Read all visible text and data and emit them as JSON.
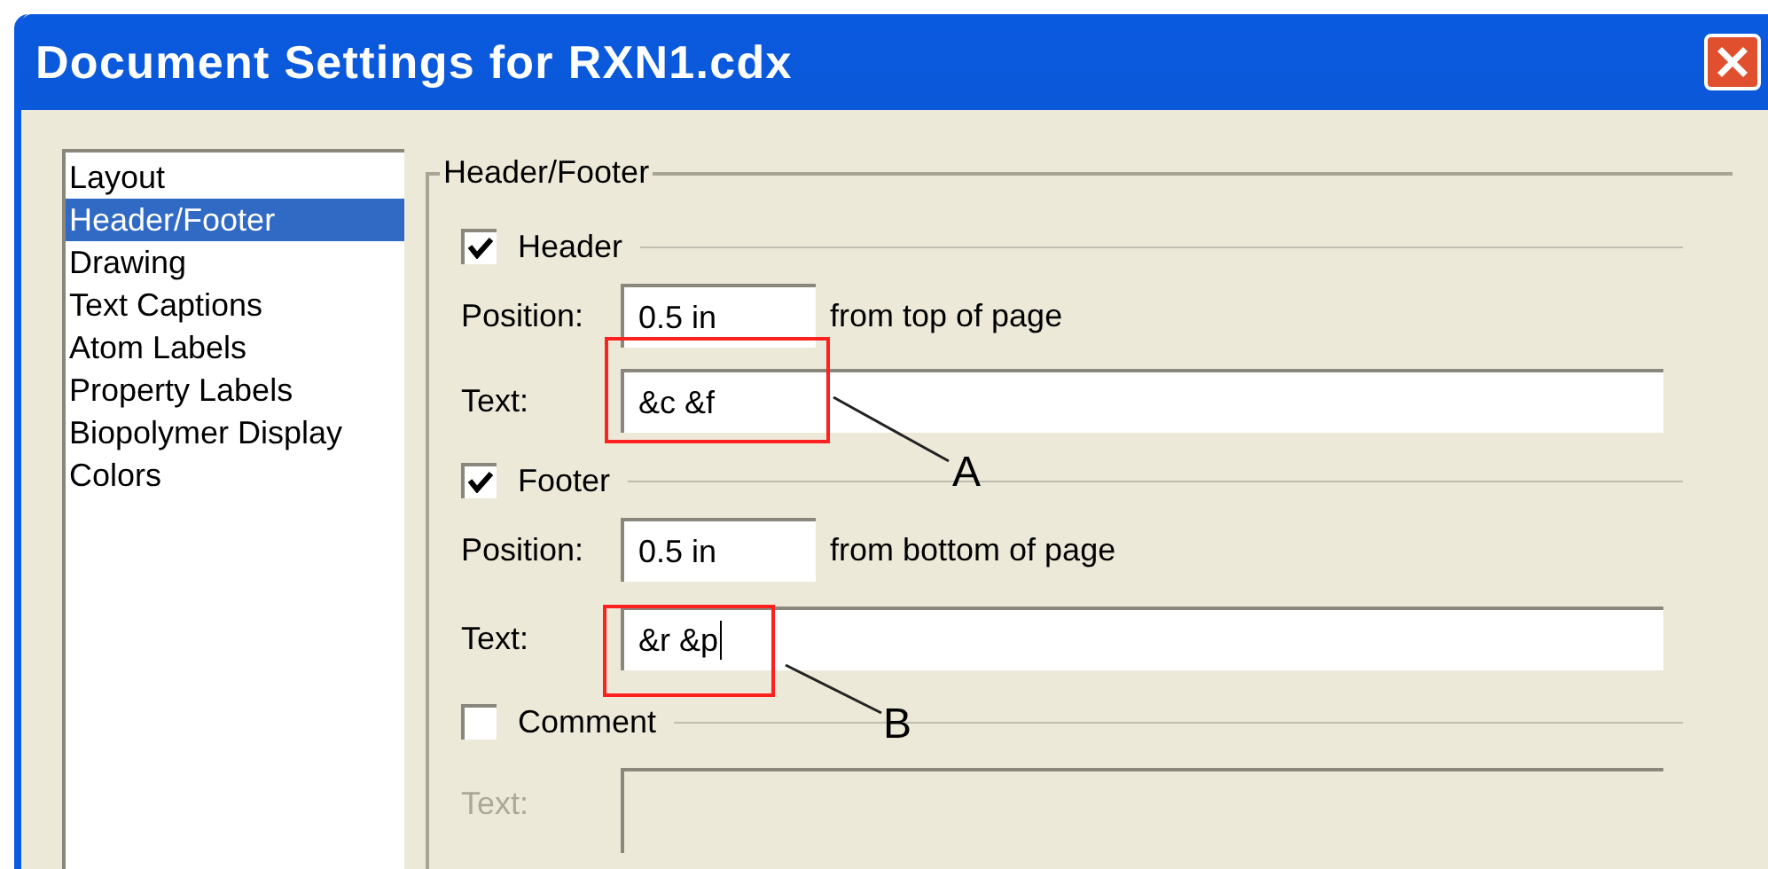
{
  "window": {
    "title": "Document Settings for RXN1.cdx"
  },
  "sidebar": {
    "items": [
      {
        "label": "Layout",
        "selected": false
      },
      {
        "label": "Header/Footer",
        "selected": true
      },
      {
        "label": "Drawing",
        "selected": false
      },
      {
        "label": "Text Captions",
        "selected": false
      },
      {
        "label": "Atom Labels",
        "selected": false
      },
      {
        "label": "Property Labels",
        "selected": false
      },
      {
        "label": "Biopolymer Display",
        "selected": false
      },
      {
        "label": "Colors",
        "selected": false
      }
    ]
  },
  "group": {
    "title": "Header/Footer"
  },
  "sections": [
    {
      "label": "Header",
      "checked": true,
      "position": {
        "label": "Position:",
        "value": "0.5 in",
        "suffix": "from top of page"
      },
      "text": {
        "label": "Text:",
        "value": "&c &f",
        "disabled": false,
        "focused": false
      }
    },
    {
      "label": "Footer",
      "checked": true,
      "position": {
        "label": "Position:",
        "value": "0.5 in",
        "suffix": "from bottom of page"
      },
      "text": {
        "label": "Text:",
        "value": "&r &p",
        "disabled": false,
        "focused": true
      }
    },
    {
      "label": "Comment",
      "checked": false,
      "text": {
        "label": "Text:",
        "disabled": true,
        "focused": false
      }
    }
  ],
  "annotations": [
    {
      "label": "A"
    },
    {
      "label": "B"
    }
  ]
}
